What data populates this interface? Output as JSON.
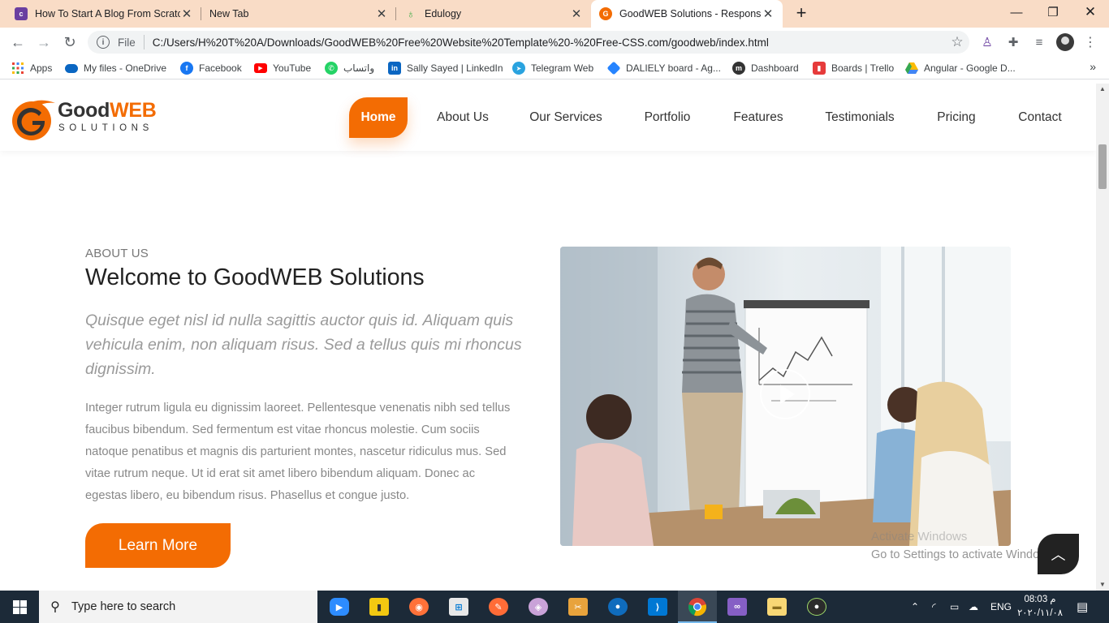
{
  "browser": {
    "tabs": [
      {
        "title": "How To Start A Blog From Scratch",
        "favicon": "colorlib-icon"
      },
      {
        "title": "New Tab",
        "favicon": ""
      },
      {
        "title": "Edulogy",
        "favicon": "edulogy-icon"
      },
      {
        "title": "GoodWEB Solutions - Responsive",
        "favicon": "goodweb-icon"
      }
    ],
    "address": {
      "scheme": "File",
      "url": "C:/Users/H%20T%20A/Downloads/GoodWEB%20Free%20Website%20Template%20-%20Free-CSS.com/goodweb/index.html"
    },
    "bookmarks": [
      {
        "label": "Apps",
        "icon": "apps-grid-icon"
      },
      {
        "label": "My files - OneDrive",
        "icon": "onedrive-icon"
      },
      {
        "label": "Facebook",
        "icon": "facebook-icon"
      },
      {
        "label": "YouTube",
        "icon": "youtube-icon"
      },
      {
        "label": "واتساب",
        "icon": "whatsapp-icon"
      },
      {
        "label": "Sally Sayed | LinkedIn",
        "icon": "linkedin-icon"
      },
      {
        "label": "Telegram Web",
        "icon": "telegram-icon"
      },
      {
        "label": "DALIELY board - Ag...",
        "icon": "jira-icon"
      },
      {
        "label": "Dashboard",
        "icon": "moodle-icon"
      },
      {
        "label": "Boards | Trello",
        "icon": "trello-icon"
      },
      {
        "label": "Angular - Google D...",
        "icon": "google-drive-icon"
      }
    ]
  },
  "site": {
    "logo": {
      "good": "Good",
      "web": "WEB",
      "sub": "SOLUTIONS"
    },
    "nav": [
      "Home",
      "About Us",
      "Our Services",
      "Portfolio",
      "Features",
      "Testimonials",
      "Pricing",
      "Contact"
    ],
    "active_nav": "Home",
    "about": {
      "eyebrow": "ABOUT US",
      "title": "Welcome to GoodWEB Solutions",
      "lead": "Quisque eget nisl id nulla sagittis auctor quis id. Aliquam quis vehicula enim, non aliquam risus. Sed a tellus quis mi rhoncus dignissim.",
      "body": "Integer rutrum ligula eu dignissim laoreet. Pellentesque venenatis nibh sed tellus faucibus bibendum. Sed fermentum est vitae rhoncus molestie. Cum sociis natoque penatibus et magnis dis parturient montes, nascetur ridiculus mus. Sed vitae rutrum neque. Ut id erat sit amet libero bibendum aliquam. Donec ac egestas libero, eu bibendum risus. Phasellus et congue justo.",
      "button": "Learn More"
    },
    "accent_color": "#f36c03"
  },
  "os": {
    "watermark_title": "Activate Windows",
    "watermark_sub": "Go to Settings to activate Windows.",
    "search_placeholder": "Type here to search",
    "language": "ENG",
    "time": "08:03 م",
    "date": "٢٠٢٠/١١/٠٨"
  }
}
